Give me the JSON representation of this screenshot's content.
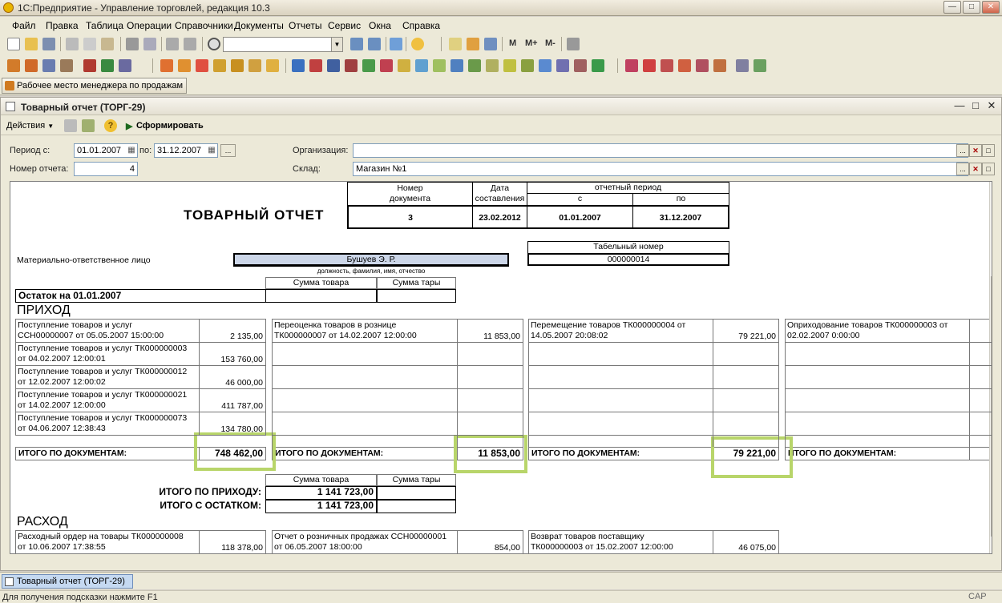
{
  "window": {
    "title": "1С:Предприятие - Управление торговлей, редакция 10.3"
  },
  "menu": [
    "Файл",
    "Правка",
    "Таблица",
    "Операции",
    "Справочники",
    "Документы",
    "Отчеты",
    "Сервис",
    "Окна",
    "Справка"
  ],
  "toolbar": {
    "zoom_m": "M",
    "zoom_mplus": "M+",
    "zoom_mminus": "M-"
  },
  "panel": {
    "manager_workplace": "Рабочее место менеджера по продажам"
  },
  "report_window": {
    "title": "Товарный отчет (ТОРГ-29)",
    "actions_label": "Действия",
    "generate_label": "Сформировать"
  },
  "form": {
    "period_label": "Период с:",
    "period_from": "01.01.2007",
    "period_to_label": "по:",
    "period_to": "31.12.2007",
    "period_btn": "...",
    "report_number_label": "Номер отчета:",
    "report_number": "4",
    "org_label": "Организация:",
    "org_value": "",
    "store_label": "Склад:",
    "store_value": "Магазин №1",
    "ellipsis": "..."
  },
  "report": {
    "hdr_docnum": [
      "Номер",
      "документа"
    ],
    "hdr_date": [
      "Дата",
      "составления"
    ],
    "hdr_period": "отчетный период",
    "hdr_from": "с",
    "hdr_to": "по",
    "title": "ТОВАРНЫЙ  ОТЧЕТ",
    "doc_number": "3",
    "doc_date": "23.02.2012",
    "period_from": "01.01.2007",
    "period_to": "31.12.2007",
    "tabnum_label": "Табельный номер",
    "tabnum_value": "000000014",
    "responsible_label": "Материально-ответственное лицо",
    "responsible_value": "Бушуев Э. Р.",
    "responsible_caption": "должность, фамилия, имя, отчество",
    "sum_goods": "Сумма товара",
    "sum_tare": "Сумма тары",
    "balance_label": "Остаток на 01.01.2007",
    "income_title": "ПРИХОД",
    "income_col1": [
      {
        "l1": "Поступление товаров и услуг",
        "l2": "ССН00000007 от 05.05.2007 15:00:00",
        "v": "2 135,00"
      },
      {
        "l1": "Поступление товаров и услуг ТК000000003",
        "l2": "от 04.02.2007 12:00:01",
        "v": "153 760,00"
      },
      {
        "l1": "Поступление товаров и услуг ТК000000012",
        "l2": "от 12.02.2007 12:00:02",
        "v": "46 000,00"
      },
      {
        "l1": "Поступление товаров и услуг ТК000000021",
        "l2": "от 14.02.2007 12:00:00",
        "v": "411 787,00"
      },
      {
        "l1": "Поступление товаров и услуг ТК000000073",
        "l2": "от 04.06.2007 12:38:43",
        "v": "134 780,00"
      }
    ],
    "income_col2": {
      "l1": "Переоценка товаров в рознице",
      "l2": "ТК000000007 от 14.02.2007 12:00:00",
      "v": "11 853,00"
    },
    "income_col3": {
      "l1": "Перемещение товаров ТК000000004 от",
      "l2": "14.05.2007 20:08:02",
      "v": "79 221,00"
    },
    "income_col4": {
      "l1": "Оприходование товаров ТК000000003 от",
      "l2": "02.02.2007 0:00:00",
      "v": ""
    },
    "total_docs_label": "ИТОГО ПО ДОКУМЕНТАМ:",
    "total_docs": [
      "748 462,00",
      "11 853,00",
      "79 221,00",
      ""
    ],
    "total_income_label": "ИТОГО ПО ПРИХОДУ:",
    "total_income": "1 141 723,00",
    "total_with_balance_label": "ИТОГО С ОСТАТКОМ:",
    "total_with_balance": "1 141 723,00",
    "expense_title": "РАСХОД",
    "expense": [
      {
        "l1": "Расходный ордер на товары ТК000000008",
        "l2": "от 10.06.2007 17:38:55",
        "v": "118 378,00"
      },
      {
        "l1": "Отчет о розничных продажах ССН00000001",
        "l2": "от 06.05.2007 18:00:00",
        "v": "854,00"
      },
      {
        "l1": "Возврат товаров поставщику",
        "l2": "ТК000000003 от 15.02.2007 12:00:00",
        "v": "46 075,00"
      }
    ]
  },
  "taskbar": {
    "tab": "Товарный отчет (ТОРГ-29)"
  },
  "status": {
    "hint": "Для получения подсказки нажмите F1",
    "caps": "CAP"
  },
  "colors": {
    "highlight": "#b8d56a",
    "window_bg": "#ece9d8"
  }
}
